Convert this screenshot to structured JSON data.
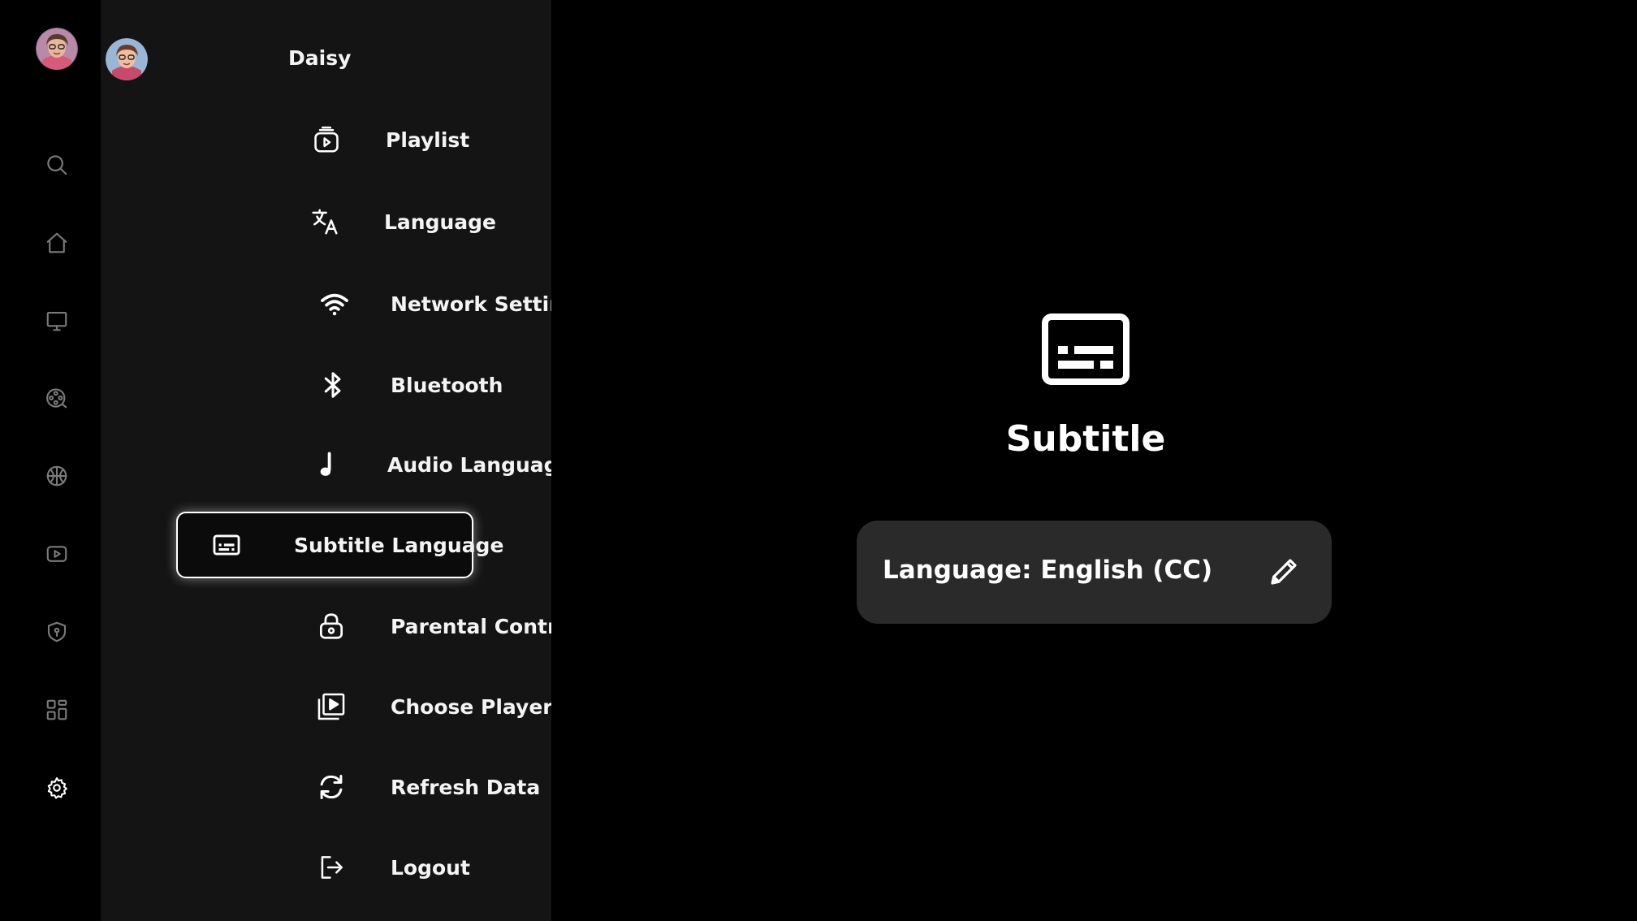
{
  "rail": {
    "items": [
      {
        "name": "search",
        "icon": "search-icon"
      },
      {
        "name": "home",
        "icon": "home-icon"
      },
      {
        "name": "tv",
        "icon": "tv-icon"
      },
      {
        "name": "movies",
        "icon": "film-reel-icon"
      },
      {
        "name": "sports",
        "icon": "sports-ball-icon"
      },
      {
        "name": "videos",
        "icon": "play-rectangle-icon"
      },
      {
        "name": "security",
        "icon": "shield-icon"
      },
      {
        "name": "apps",
        "icon": "grid-icon"
      },
      {
        "name": "settings",
        "icon": "gear-icon",
        "active": true
      }
    ]
  },
  "menu": {
    "profile_name": "Daisy",
    "items": [
      {
        "label": "Playlist",
        "icon": "playlist-icon"
      },
      {
        "label": "Language",
        "icon": "translate-icon"
      },
      {
        "label": "Network Settings",
        "icon": "wifi-icon"
      },
      {
        "label": "Bluetooth",
        "icon": "bluetooth-icon"
      },
      {
        "label": "Audio Language",
        "icon": "music-note-icon"
      },
      {
        "label": "Subtitle Language",
        "icon": "subtitles-icon",
        "selected": true
      },
      {
        "label": "Parental Control",
        "icon": "lock-icon"
      },
      {
        "label": "Choose Player",
        "icon": "video-library-icon"
      },
      {
        "label": "Refresh Data",
        "icon": "refresh-icon"
      },
      {
        "label": "Logout",
        "icon": "logout-icon"
      }
    ]
  },
  "content": {
    "icon": "subtitles-icon",
    "title": "Subtitle",
    "language_value": "Language: English (CC)",
    "edit_icon": "pencil-icon"
  },
  "colors": {
    "background": "#000000",
    "menu_panel": "#141414",
    "card": "#2a2a2a",
    "rail_icon": "#7a7a7a",
    "text": "#ffffff"
  }
}
